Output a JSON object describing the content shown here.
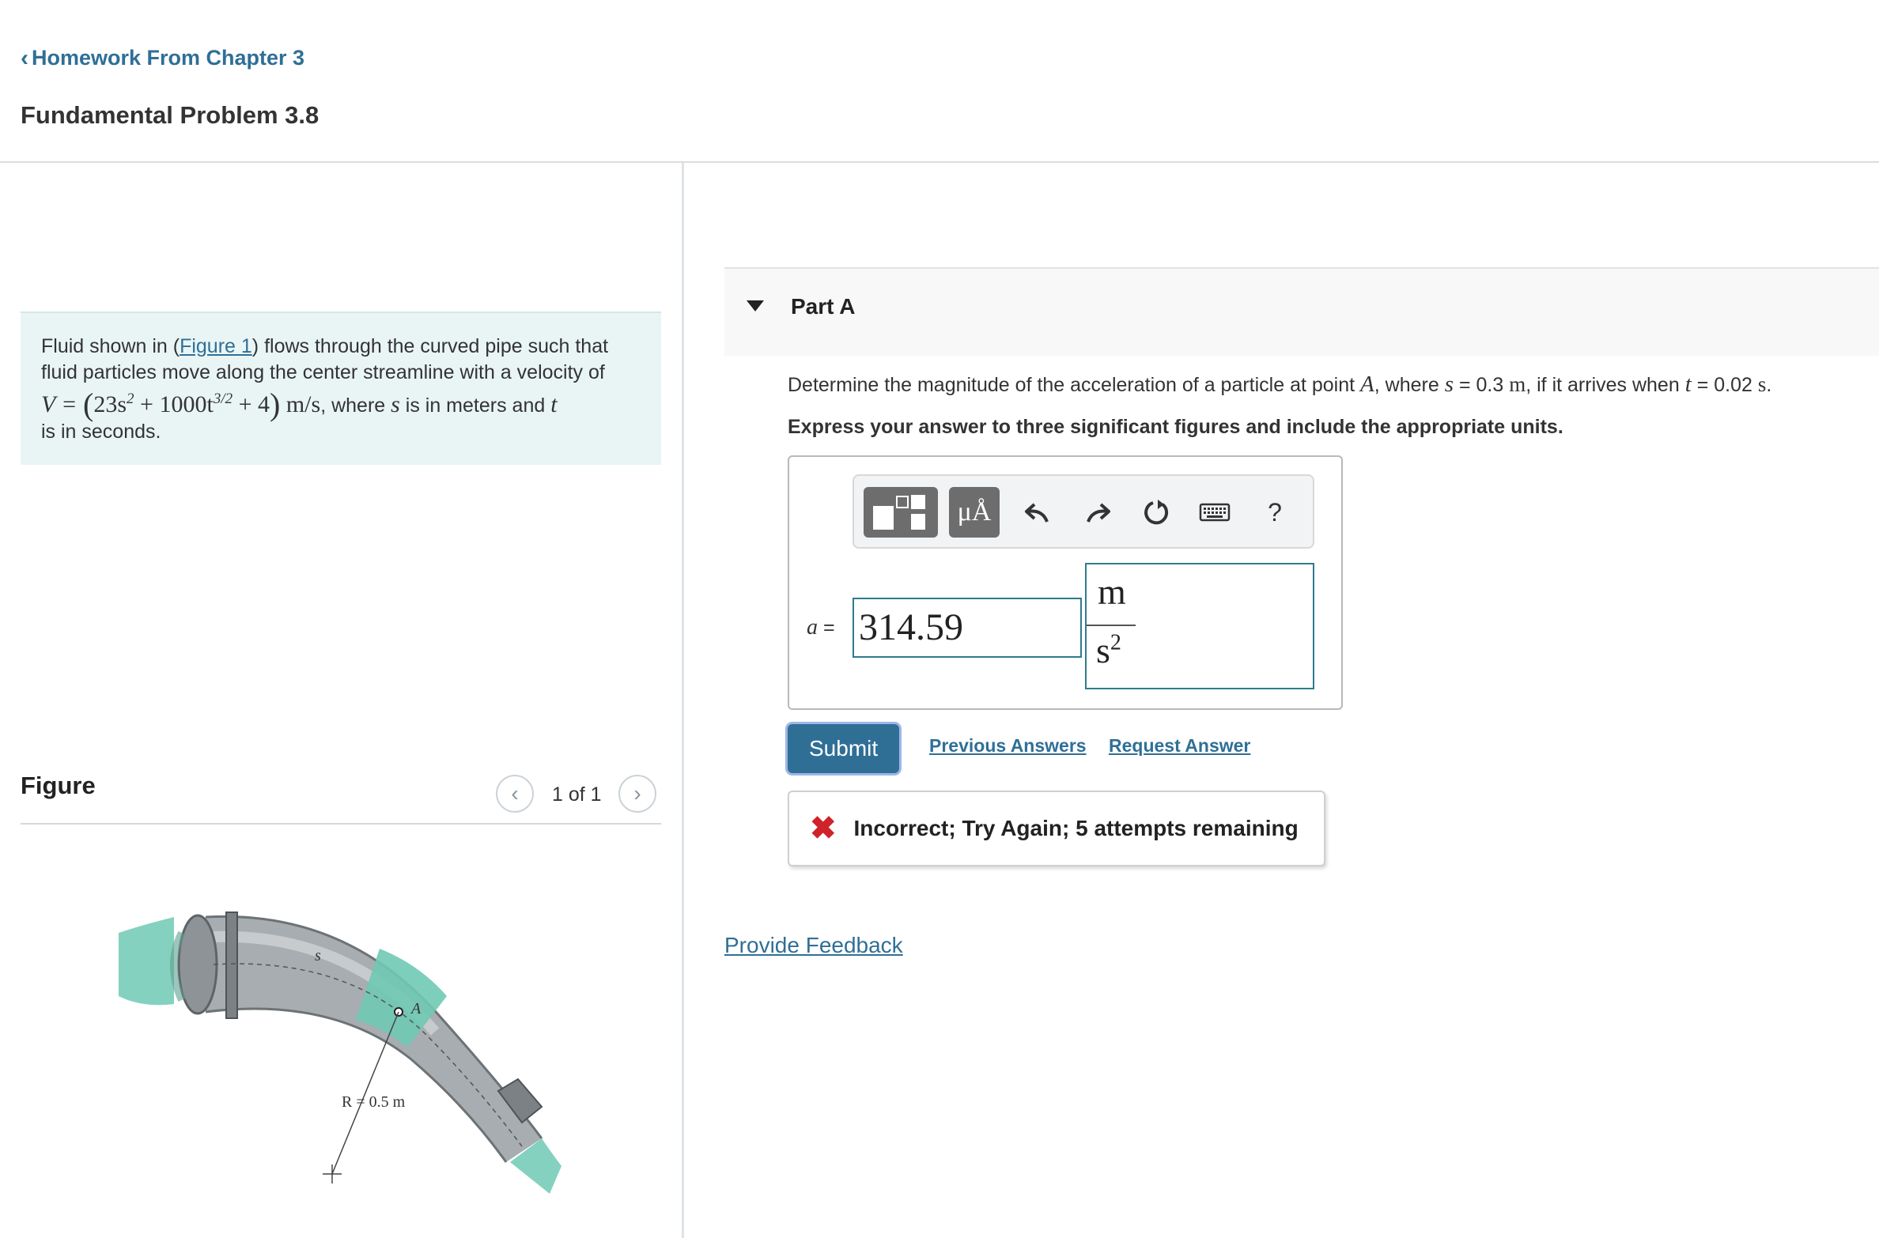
{
  "header": {
    "back_link": "Homework From Chapter 3",
    "title": "Fundamental Problem 3.8"
  },
  "problem": {
    "text_before_link": "Fluid shown in (",
    "figure_link": "Figure 1",
    "text_after_link": ") flows through the curved pipe such that fluid particles move along the center streamline with a velocity of",
    "equation": {
      "lhs": "V =",
      "term1": "23s",
      "exp1": "2",
      "term2": "+ 1000t",
      "exp2": "3/2",
      "term3": "+ 4",
      "units": "m/s"
    },
    "text_where": ", where",
    "var_s": "s",
    "text_meters": "is in meters and",
    "var_t": "t",
    "text_seconds": "is in seconds."
  },
  "figure": {
    "title": "Figure",
    "counter": "1 of 1",
    "label_s": "s",
    "label_A": "A",
    "label_R": "R = 0.5 m",
    "colors": {
      "pipe": "#a8adb1",
      "fluid": "#6fc9b4"
    }
  },
  "part": {
    "label": "Part A",
    "question": {
      "t1": "Determine the magnitude of the acceleration of a particle at point",
      "A": "A",
      "t2": ", where",
      "s": "s",
      "t3": "= 0.3",
      "u1": "m",
      "t4": ", if it arrives when",
      "t": "t",
      "t5": "= 0.02",
      "u2": "s",
      "t6": "."
    },
    "instruction": "Express your answer to three significant figures and include the appropriate units."
  },
  "toolbar": {
    "units_label": "μÅ",
    "help_label": "?",
    "icons": [
      "template-icon",
      "units-icon",
      "undo-icon",
      "redo-icon",
      "reset-icon",
      "keyboard-icon",
      "help-icon"
    ]
  },
  "answer": {
    "variable": "a",
    "equals": "=",
    "value": "314.59",
    "unit_numerator": "m",
    "unit_denominator": "s",
    "unit_denominator_exp": "2"
  },
  "actions": {
    "submit": "Submit",
    "previous_answers": "Previous Answers",
    "request_answer": "Request Answer"
  },
  "feedback": {
    "message": "Incorrect; Try Again; 5 attempts remaining"
  },
  "footer": {
    "provide_feedback": "Provide Feedback"
  },
  "colors": {
    "link": "#2f6f96",
    "problem_bg": "#e9f5f5",
    "error": "#d0222a",
    "input_border": "#2f7a8f"
  }
}
